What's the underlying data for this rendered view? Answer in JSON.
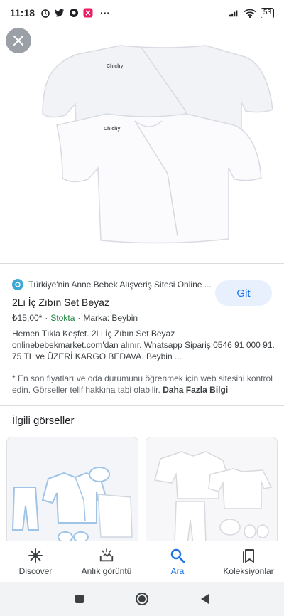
{
  "status_bar": {
    "time": "11:18",
    "more": "···",
    "battery": "53",
    "left_icons": [
      "alarm-icon",
      "twitter-icon",
      "chrome-icon",
      "app-x-icon"
    ],
    "right_icons": [
      "signal-icon",
      "wifi-icon",
      "battery-icon"
    ]
  },
  "hero": {
    "image_alt": "2Li İç Zıbın Set Beyaz",
    "logo_text_1": "Chichy",
    "logo_text_2": "Chichy"
  },
  "result": {
    "source": "Türkiye'nin Anne Bebek Alışveriş Sitesi Online ...",
    "visit_label": "Git",
    "title": "2Li İç Zıbın Set Beyaz",
    "price": "₺15,00*",
    "separator": "·",
    "stock": "Stokta",
    "brand": "Marka: Beybin",
    "description": "Hemen Tıkla Keşfet. 2Li İç Zıbın Set Beyaz onlinebebekmarket.com'dan alınır. Whatsapp Sipariş:0546 91 000 91. 75 TL ve ÜZERİ KARGO BEDAVA. Beybin ...",
    "disclaimer": "* En son fiyatları ve oda durumunu öğrenmek için web sitesini kontrol edin. Görseller telif hakkına tabi olabilir.",
    "more_info": "Daha Fazla Bilgi"
  },
  "related": {
    "title": "İlgili görseller"
  },
  "bottom_nav": [
    {
      "label": "Discover",
      "icon": "discover-icon"
    },
    {
      "label": "Anlık görüntü",
      "icon": "snapshot-icon"
    },
    {
      "label": "Ara",
      "icon": "search-icon",
      "active": true
    },
    {
      "label": "Koleksiyonlar",
      "icon": "collections-icon"
    }
  ],
  "system_nav": [
    "recents-icon",
    "home-icon",
    "back-icon"
  ],
  "colors": {
    "accent": "#1a73e8",
    "stock": "#188038",
    "button_bg": "#e8f0fe"
  }
}
